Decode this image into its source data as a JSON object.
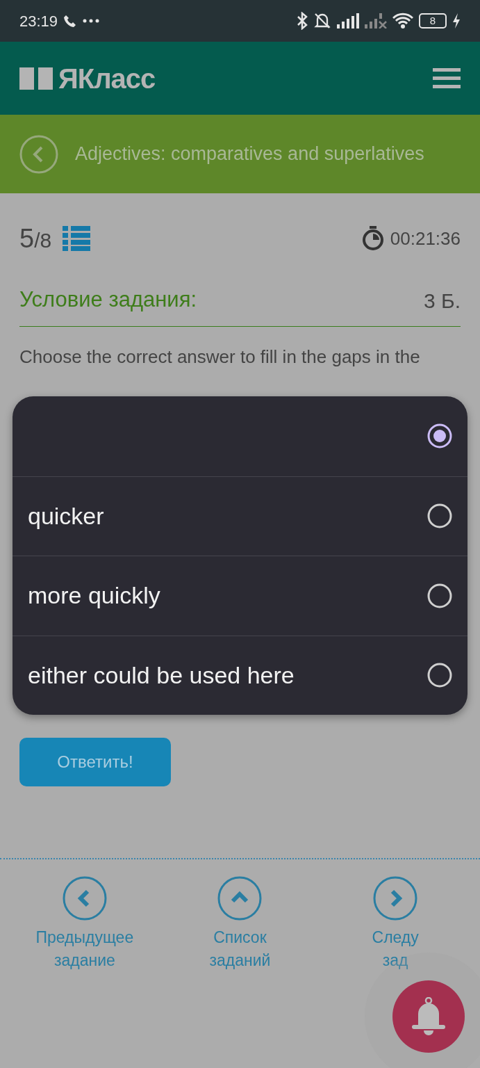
{
  "status_bar": {
    "time": "23:19",
    "battery": "8"
  },
  "header": {
    "logo": "ЯКласс"
  },
  "topic": {
    "title": "Adjectives: comparatives and superlatives"
  },
  "task": {
    "current": "5",
    "total": "/8",
    "timer": "00:21:36"
  },
  "condition": {
    "heading": "Условие задания:",
    "points": "3 Б."
  },
  "instruction": "Choose the correct answer to fill in the gaps in the",
  "dropdown": {
    "options": [
      {
        "selected": true
      },
      {
        "label": "quicker",
        "selected": false
      },
      {
        "label": "more quickly",
        "selected": false
      },
      {
        "label": "either could be used here",
        "selected": false
      }
    ]
  },
  "submit_button": "Ответить!",
  "nav": [
    {
      "kind": "previous",
      "lines": [
        "Предыдущее",
        "задание"
      ]
    },
    {
      "kind": "list",
      "lines": [
        "Список",
        "заданий"
      ]
    },
    {
      "kind": "next",
      "lines": [
        "Следу",
        "зад"
      ]
    }
  ]
}
